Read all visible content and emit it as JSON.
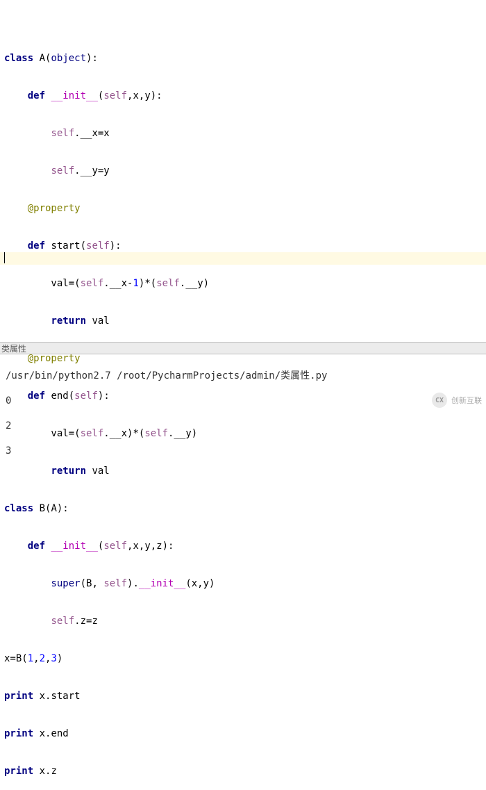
{
  "code": {
    "l1_class": "class",
    "l1_name": " A(",
    "l1_obj": "object",
    "l1_end": "):",
    "l2_def": "    def",
    "l2_init": " __init__",
    "l2_open": "(",
    "l2_self": "self",
    "l2_rest": ",x,y):",
    "l3_pre": "        ",
    "l3_self": "self",
    "l3_rest": ".__x=x",
    "l4_pre": "        ",
    "l4_self": "self",
    "l4_rest": ".__y=y",
    "l5_pre": "    ",
    "l5_dec": "@property",
    "l6_def": "    def",
    "l6_name": " start(",
    "l6_self": "self",
    "l6_end": "):",
    "l7_pre": "        val=(",
    "l7_self1": "self",
    "l7_mid": ".__x-",
    "l7_num": "1",
    "l7_mid2": ")*(",
    "l7_self2": "self",
    "l7_end": ".__y)",
    "l8_pre": "        ",
    "l8_ret": "return",
    "l8_end": " val",
    "l9_pre": "    ",
    "l9_dec": "@property",
    "l10_def": "    def",
    "l10_name": " end(",
    "l10_self": "self",
    "l10_end": "):",
    "l11_pre": "        val=(",
    "l11_self1": "self",
    "l11_mid": ".__x)*(",
    "l11_self2": "self",
    "l11_end": ".__y)",
    "l12_pre": "        ",
    "l12_ret": "return",
    "l12_end": " val",
    "l13_class": "class",
    "l13_rest": " B(A):",
    "l14_def": "    def",
    "l14_init": " __init__",
    "l14_open": "(",
    "l14_self": "self",
    "l14_rest": ",x,y,z):",
    "l15_pre": "        ",
    "l15_super": "super",
    "l15_mid": "(B, ",
    "l15_self": "self",
    "l15_mid2": ").",
    "l15_init": "__init__",
    "l15_end": "(x,y)",
    "l16_pre": "        ",
    "l16_self": "self",
    "l16_rest": ".z=z",
    "l17_pre": "x=B(",
    "l17_n1": "1",
    "l17_c1": ",",
    "l17_n2": "2",
    "l17_c2": ",",
    "l17_n3": "3",
    "l17_end": ")",
    "l18_print": "print",
    "l18_rest": " x.start",
    "l19_print": "print",
    "l19_rest": " x.end",
    "l20_print": "print",
    "l20_rest": " x.z"
  },
  "panel": {
    "title": "类属性"
  },
  "console": {
    "cmd": "/usr/bin/python2.7 /root/PycharmProjects/admin/类属性.py",
    "out1": "0",
    "out2": "2",
    "out3": "3"
  },
  "watermark": {
    "logo": "CX",
    "text": "创新互联"
  }
}
